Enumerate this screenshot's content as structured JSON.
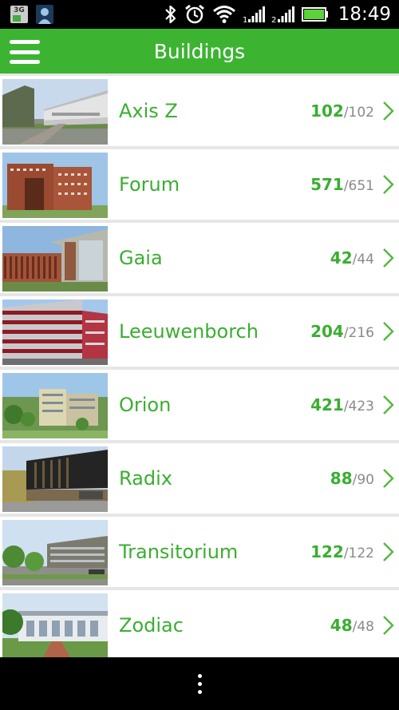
{
  "status_bar": {
    "network_badge": "3G",
    "time": "18:49",
    "sim1_label": "1",
    "sim2_label": "2"
  },
  "app_bar": {
    "title": "Buildings"
  },
  "buildings": [
    {
      "name": "Axis Z",
      "available": "102",
      "total": "102"
    },
    {
      "name": "Forum",
      "available": "571",
      "total": "651"
    },
    {
      "name": "Gaia",
      "available": "42",
      "total": "44"
    },
    {
      "name": "Leeuwenborch",
      "available": "204",
      "total": "216"
    },
    {
      "name": "Orion",
      "available": "421",
      "total": "423"
    },
    {
      "name": "Radix",
      "available": "88",
      "total": "90"
    },
    {
      "name": "Transitorium",
      "available": "122",
      "total": "122"
    },
    {
      "name": "Zodiac",
      "available": "48",
      "total": "48"
    }
  ],
  "colors": {
    "accent": "#3cb432",
    "text_green": "#3aae30",
    "total_gray": "#8a8a8a"
  }
}
